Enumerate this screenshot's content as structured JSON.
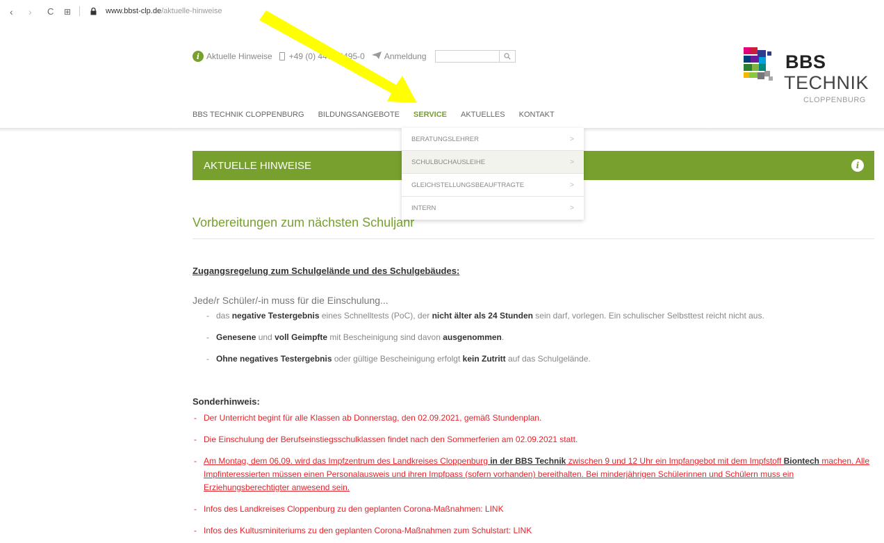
{
  "browser": {
    "back_icon": "‹",
    "forward_icon": "›",
    "reload_icon": "C",
    "apps_icon": "⊞",
    "lock_icon": "🔒",
    "url_domain": "www.bbst-clp.de",
    "url_path": "/aktuelle-hinweise"
  },
  "topbar": {
    "hinweise": "Aktuelle Hinweise",
    "phone": "+49 (0) 4471 9495-0",
    "anmeldung": "Anmeldung",
    "search_placeholder": ""
  },
  "logo": {
    "line1": "BBS",
    "line2": "TECHNIK",
    "line3": "CLOPPENBURG"
  },
  "nav": {
    "items": [
      "BBS TECHNIK CLOPPENBURG",
      "BILDUNGSANGEBOTE",
      "SERVICE",
      "AKTUELLES",
      "KONTAKT"
    ]
  },
  "dropdown": {
    "items": [
      "BERATUNGSLEHRER",
      "SCHULBUCHAUSLEIHE",
      "GLEICHSTELLUNGSBEAUFTRAGTE",
      "INTERN"
    ],
    "arrow": ">"
  },
  "section": {
    "title": "AKTUELLE HINWEISE"
  },
  "article": {
    "title": "Vorbereitungen zum nächsten Schuljahr",
    "subheading": "Zugangsregelung zum Schulgelände und des Schulgebäudes:",
    "intro": "Jede/r Schüler/-in muss für die Einschulung...",
    "b1_a": "das ",
    "b1_b": "negative Testergebnis",
    "b1_c": " eines Schnelltests (PoC), der ",
    "b1_d": "nicht älter als 24 Stunden",
    "b1_e": " sein darf, vorlegen. Ein schulischer Selbsttest reicht nicht aus.",
    "b2_a": "Genesene",
    "b2_b": " und ",
    "b2_c": "voll Geimpfte",
    "b2_d": " mit Bescheinigung sind davon ",
    "b2_e": "ausgenommen",
    "b2_f": ".",
    "b3_a": "Ohne negatives Testergebnis",
    "b3_b": " oder gültige Bescheinigung erfolgt ",
    "b3_c": "kein Zutritt",
    "b3_d": " auf das Schulgelände.",
    "sonder": "Sonderhinweis:",
    "r1": "Der Unterricht begint für alle Klassen ab Donnerstag, den 02.09.2021, gemäß Stundenplan.",
    "r2": "Die Einschulung der Berufseinstiegsschulklassen findet nach den Sommerferien am 02.09.2021 statt.",
    "r3_a": "Am Montag, dem 06.09. wird das Impfzentrum des Landkreises Cloppenburg",
    "r3_b": " in der BBS Technik",
    "r3_c": " zwischen 9 und 12 Uhr ein Impfangebot mit dem Impfstoff ",
    "r3_d": "Biontech",
    "r3_e": " machen. Alle Impfinteressierten müssen einen Personalausweis und ihren Impfpass (sofern vorhanden) bereithalten. Bei minderjährigen Schülerinnen und Schülern muss ein Erziehungsberechtigter anwesend sein.",
    "r4": "Infos des Landkreises Cloppenburg zu den geplanten Corona-Maßnahmen: LINK",
    "r5": "Infos des Kultusminiteriums zu den geplanten Corona-Maßnahmen zum Schulstart: LINK"
  },
  "colors": {
    "brand_green": "#77a02f",
    "alert_red": "#e3242b",
    "arrow_yellow": "#ffff00"
  }
}
